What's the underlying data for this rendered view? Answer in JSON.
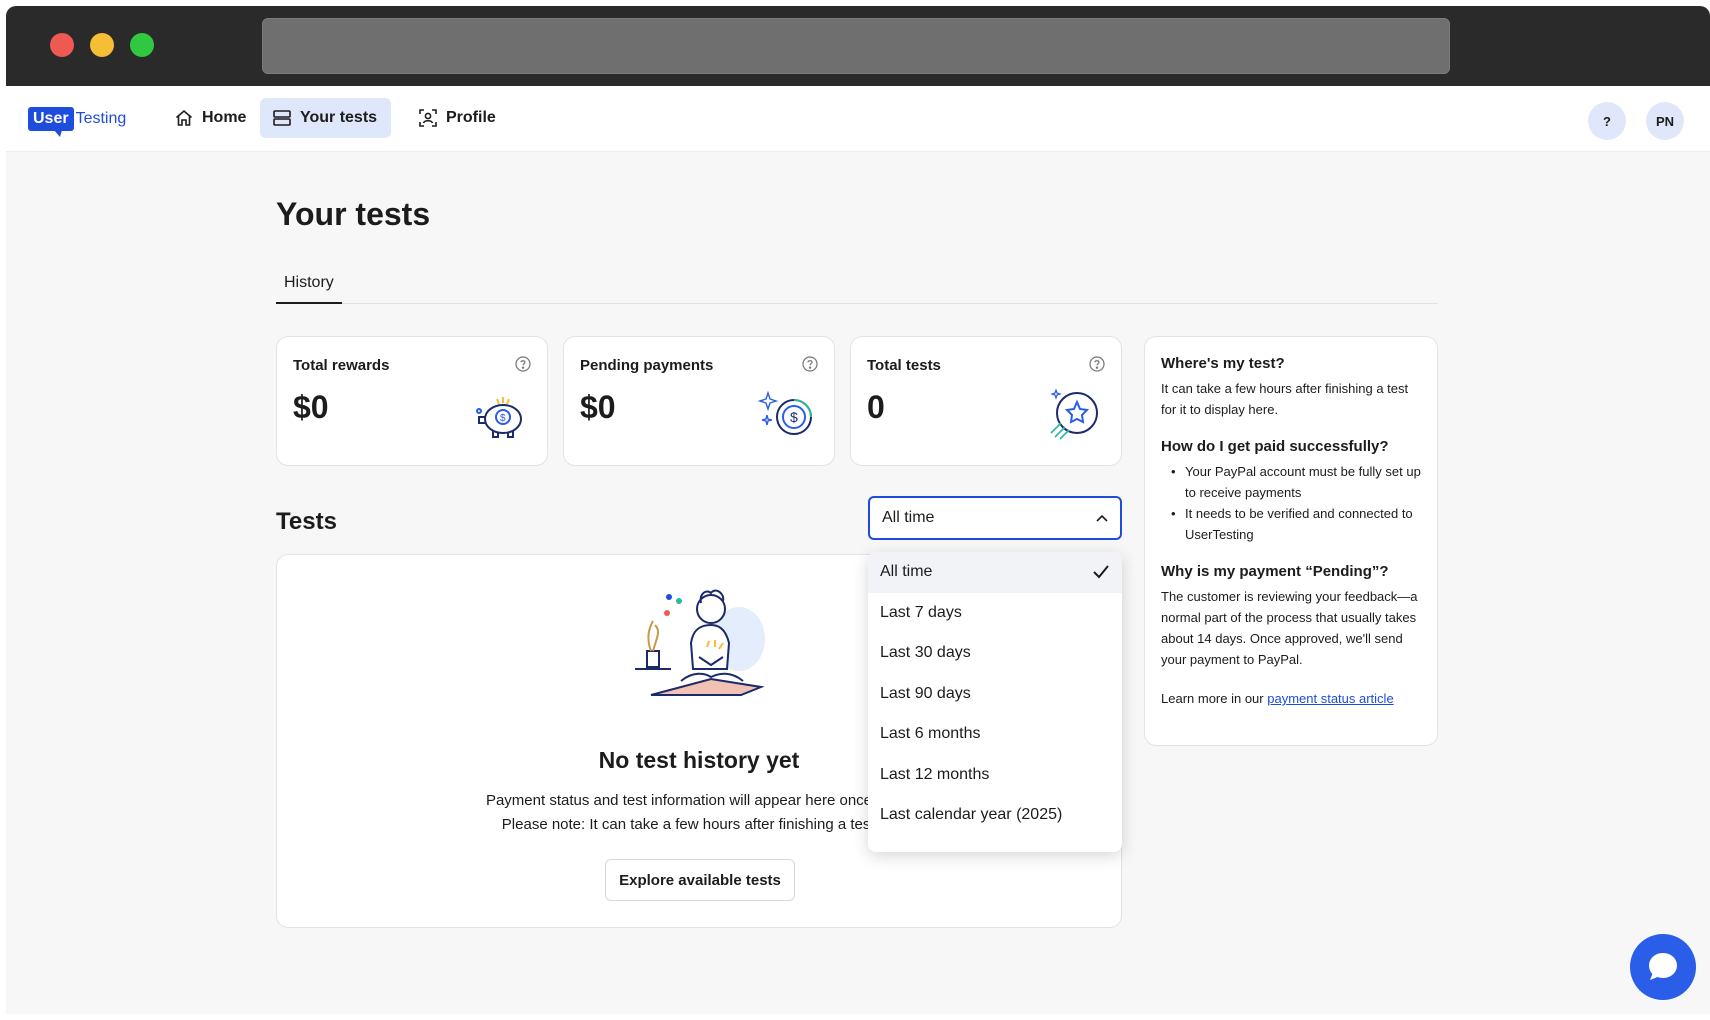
{
  "nav": {
    "logo_user": "User",
    "logo_testing": "Testing",
    "home": "Home",
    "your_tests": "Your tests",
    "profile": "Profile",
    "help": "?",
    "avatar": "PN"
  },
  "page": {
    "title": "Your tests",
    "tab_history": "History"
  },
  "stats": [
    {
      "label": "Total rewards",
      "value": "$0",
      "icon": "piggy-bank-icon"
    },
    {
      "label": "Pending payments",
      "value": "$0",
      "icon": "coin-sparkle-icon"
    },
    {
      "label": "Total tests",
      "value": "0",
      "icon": "star-badge-icon"
    }
  ],
  "info": {
    "q1": "Where's my test?",
    "a1": "It can take a few hours after finishing a test for it to display here.",
    "q2": "How do I get paid successfully?",
    "bullet1": "Your PayPal account must be fully set up to receive payments",
    "bullet2": "It needs to be verified and connected to UserTesting",
    "q3": "Why is my payment “Pending”?",
    "a3": "The customer is reviewing your feedback—a normal part of the process that usually takes about 14 days. Once approved, we'll send your payment to PayPal.",
    "learn_prefix": "Learn more in our ",
    "learn_link": "payment status article"
  },
  "tests": {
    "heading": "Tests",
    "filter_value": "All time",
    "empty_title": "No test history yet",
    "empty_line1": "Payment status and test information will appear here once you s",
    "empty_line2": "Please note: It can take a few hours after finishing a test for",
    "explore_button": "Explore available tests"
  },
  "dropdown": {
    "options": [
      "All time",
      "Last 7 days",
      "Last 30 days",
      "Last 90 days",
      "Last 6 months",
      "Last 12 months",
      "Last calendar year (2025)"
    ],
    "selected_index": 0
  },
  "colors": {
    "brand": "#1e4cdc",
    "nav_active": "#dfe7fb",
    "chat": "#2a5de8"
  }
}
